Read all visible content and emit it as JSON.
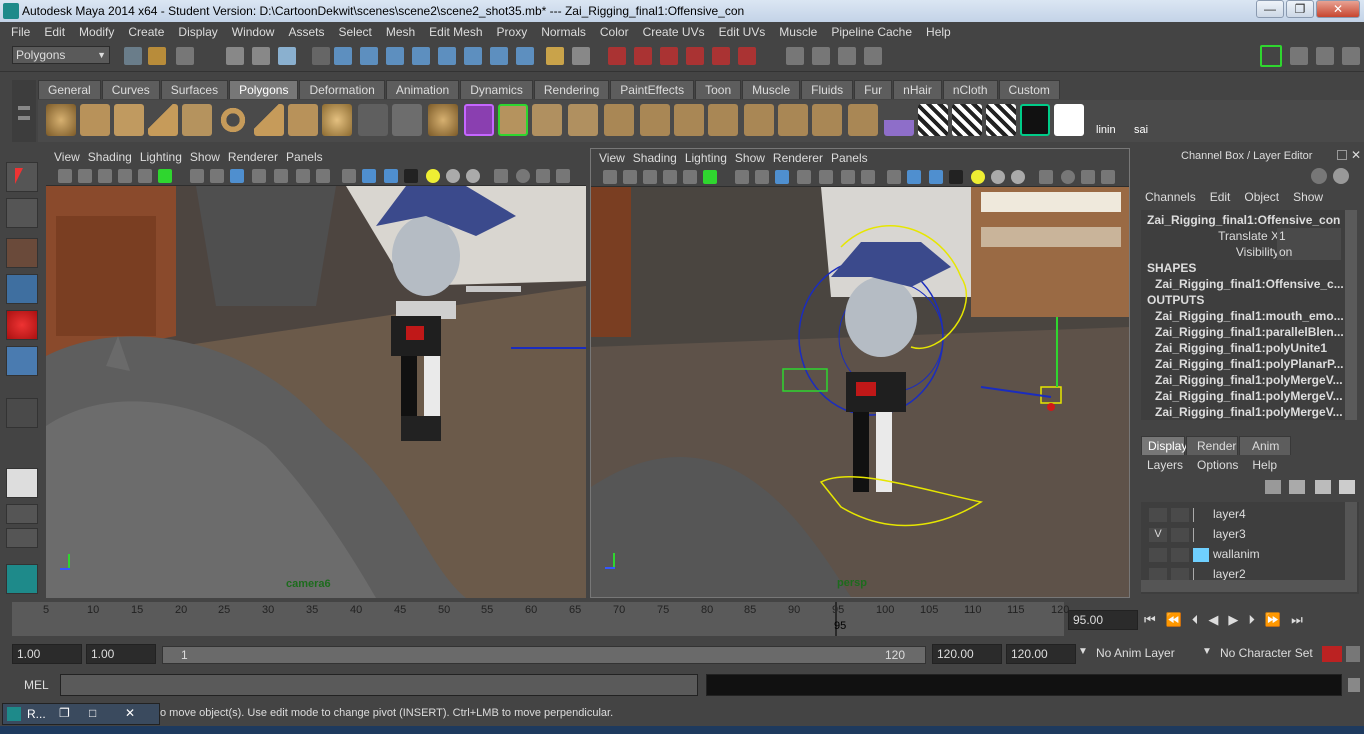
{
  "window": {
    "title": "Autodesk Maya 2014 x64 - Student Version: D:\\CartoonDekwit\\scenes\\scene2\\scene2_shot35.mb*  ---  Zai_Rigging_final1:Offensive_con",
    "min": "—",
    "max": "❐",
    "close": "✕"
  },
  "menus": [
    "File",
    "Edit",
    "Modify",
    "Create",
    "Display",
    "Window",
    "Assets",
    "Select",
    "Mesh",
    "Edit Mesh",
    "Proxy",
    "Normals",
    "Color",
    "Create UVs",
    "Edit UVs",
    "Muscle",
    "Pipeline Cache",
    "Help"
  ],
  "mode_selector": "Polygons",
  "shelf_tabs": [
    "General",
    "Curves",
    "Surfaces",
    "Polygons",
    "Deformation",
    "Animation",
    "Dynamics",
    "Rendering",
    "PaintEffects",
    "Toon",
    "Muscle",
    "Fluids",
    "Fur",
    "nHair",
    "nCloth",
    "Custom"
  ],
  "shelf_active": "Polygons",
  "shelf_labels": {
    "linin": "linin",
    "sai": "sai"
  },
  "viewport_menu": [
    "View",
    "Shading",
    "Lighting",
    "Show",
    "Renderer",
    "Panels"
  ],
  "viewports": {
    "left_camera": "camera6",
    "right_camera": "persp"
  },
  "channel_box": {
    "header": "Channel Box / Layer Editor",
    "menu": [
      "Channels",
      "Edit",
      "Object",
      "Show"
    ],
    "object_name": "Zai_Rigging_final1:Offensive_con",
    "attrs": [
      {
        "name": "Translate X",
        "value": "1"
      },
      {
        "name": "Visibility",
        "value": "on"
      }
    ],
    "shapes_label": "SHAPES",
    "shapes": [
      "Zai_Rigging_final1:Offensive_c..."
    ],
    "outputs_label": "OUTPUTS",
    "outputs": [
      "Zai_Rigging_final1:mouth_emo...",
      "Zai_Rigging_final1:parallelBlen...",
      "Zai_Rigging_final1:polyUnite1",
      "Zai_Rigging_final1:polyPlanarP...",
      "Zai_Rigging_final1:polyMergeV...",
      "Zai_Rigging_final1:polyMergeV...",
      "Zai_Rigging_final1:polyMergeV..."
    ]
  },
  "layer_editor": {
    "tabs": [
      "Display",
      "Render",
      "Anim"
    ],
    "active_tab": "Display",
    "menu": [
      "Layers",
      "Options",
      "Help"
    ],
    "layers": [
      {
        "v": "",
        "name": "layer4",
        "color": ""
      },
      {
        "v": "V",
        "name": "layer3",
        "color": ""
      },
      {
        "v": "",
        "name": "wallanim",
        "color": "#6fd0ff"
      },
      {
        "v": "",
        "name": "layer2",
        "color": ""
      }
    ]
  },
  "time_slider": {
    "ticks": [
      "5",
      "10",
      "15",
      "20",
      "25",
      "30",
      "35",
      "40",
      "45",
      "50",
      "55",
      "60",
      "65",
      "70",
      "75",
      "80",
      "85",
      "90",
      "95",
      "100",
      "105",
      "110",
      "115",
      "120"
    ],
    "current_frame_label": "95",
    "current_frame_field": "95.00"
  },
  "range_slider": {
    "start": "1.00",
    "anim_start": "1.00",
    "range_start": "1",
    "range_end": "120",
    "anim_end": "120.00",
    "end": "120.00",
    "anim_layer": "No Anim Layer",
    "char_set": "No Character Set"
  },
  "command_line": {
    "label": "MEL"
  },
  "help_line": {
    "text": "o move object(s). Use edit mode to change pivot (INSERT).  Ctrl+LMB to move perpendicular."
  },
  "minimized_window": {
    "label": "R...",
    "restore": "❐",
    "max": "□",
    "close": "✕"
  },
  "colors": {
    "accent_green": "#2fd62f",
    "active_layer_color": "#6fd0ff"
  }
}
